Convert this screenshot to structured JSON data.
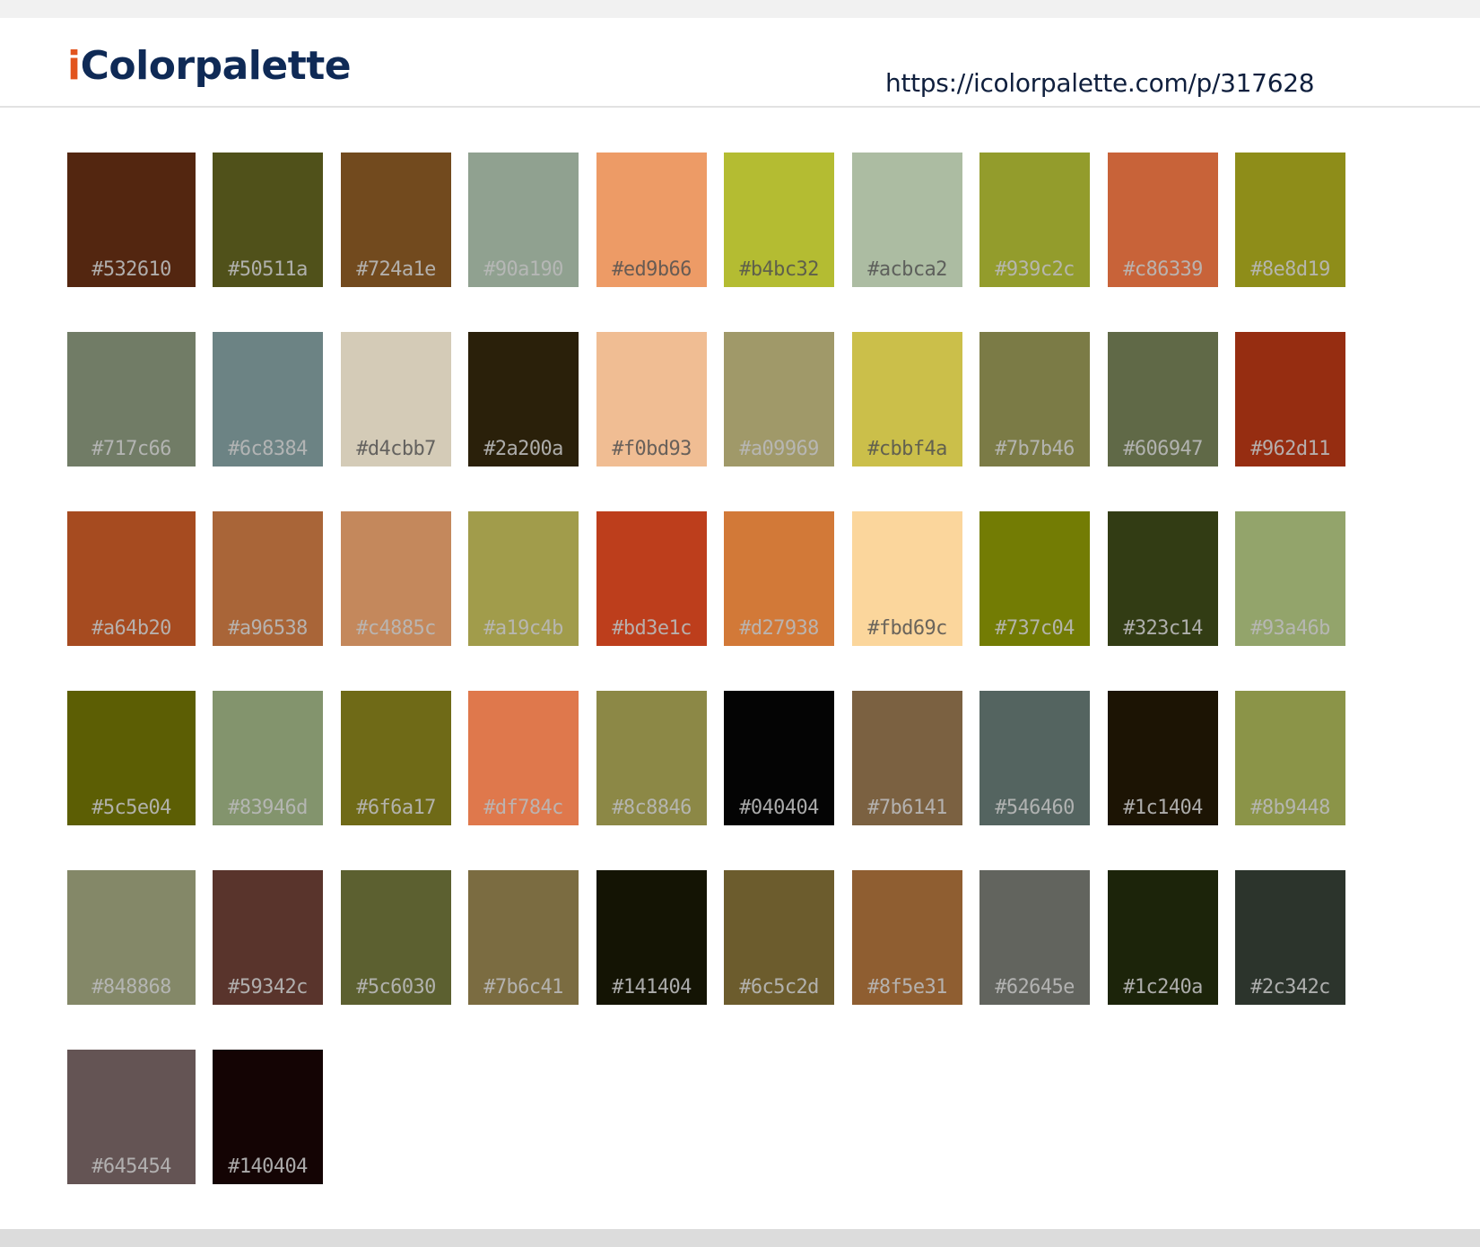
{
  "header": {
    "logo_i": "i",
    "logo_rest": "Colorpalette",
    "url": "https://icolorpalette.com/p/317628"
  },
  "swatches": [
    {
      "hex": "#532610",
      "label": "#532610"
    },
    {
      "hex": "#50511a",
      "label": "#50511a"
    },
    {
      "hex": "#724a1e",
      "label": "#724a1e"
    },
    {
      "hex": "#90a190",
      "label": "#90a190"
    },
    {
      "hex": "#ed9b66",
      "label": "#ed9b66"
    },
    {
      "hex": "#b4bc32",
      "label": "#b4bc32"
    },
    {
      "hex": "#acbca2",
      "label": "#acbca2"
    },
    {
      "hex": "#939c2c",
      "label": "#939c2c"
    },
    {
      "hex": "#c86339",
      "label": "#c86339"
    },
    {
      "hex": "#8e8d19",
      "label": "#8e8d19"
    },
    {
      "hex": "#717c66",
      "label": "#717c66"
    },
    {
      "hex": "#6c8384",
      "label": "#6c8384"
    },
    {
      "hex": "#d4cbb7",
      "label": "#d4cbb7"
    },
    {
      "hex": "#2a200a",
      "label": "#2a200a"
    },
    {
      "hex": "#f0bd93",
      "label": "#f0bd93"
    },
    {
      "hex": "#a09969",
      "label": "#a09969"
    },
    {
      "hex": "#cbbf4a",
      "label": "#cbbf4a"
    },
    {
      "hex": "#7b7b46",
      "label": "#7b7b46"
    },
    {
      "hex": "#606947",
      "label": "#606947"
    },
    {
      "hex": "#962d11",
      "label": "#962d11"
    },
    {
      "hex": "#a64b20",
      "label": "#a64b20"
    },
    {
      "hex": "#a96538",
      "label": "#a96538"
    },
    {
      "hex": "#c4885c",
      "label": "#c4885c"
    },
    {
      "hex": "#a19c4b",
      "label": "#a19c4b"
    },
    {
      "hex": "#bd3e1c",
      "label": "#bd3e1c"
    },
    {
      "hex": "#d27938",
      "label": "#d27938"
    },
    {
      "hex": "#fbd69c",
      "label": "#fbd69c"
    },
    {
      "hex": "#737c04",
      "label": "#737c04"
    },
    {
      "hex": "#323c14",
      "label": "#323c14"
    },
    {
      "hex": "#93a46b",
      "label": "#93a46b"
    },
    {
      "hex": "#5c5e04",
      "label": "#5c5e04"
    },
    {
      "hex": "#83946d",
      "label": "#83946d"
    },
    {
      "hex": "#6f6a17",
      "label": "#6f6a17"
    },
    {
      "hex": "#df784c",
      "label": "#df784c"
    },
    {
      "hex": "#8c8846",
      "label": "#8c8846"
    },
    {
      "hex": "#040404",
      "label": "#040404"
    },
    {
      "hex": "#7b6141",
      "label": "#7b6141"
    },
    {
      "hex": "#546460",
      "label": "#546460"
    },
    {
      "hex": "#1c1404",
      "label": "#1c1404"
    },
    {
      "hex": "#8b9448",
      "label": "#8b9448"
    },
    {
      "hex": "#848868",
      "label": "#848868"
    },
    {
      "hex": "#59342c",
      "label": "#59342c"
    },
    {
      "hex": "#5c6030",
      "label": "#5c6030"
    },
    {
      "hex": "#7b6c41",
      "label": "#7b6c41"
    },
    {
      "hex": "#141404",
      "label": "#141404"
    },
    {
      "hex": "#6c5c2d",
      "label": "#6c5c2d"
    },
    {
      "hex": "#8f5e31",
      "label": "#8f5e31"
    },
    {
      "hex": "#62645e",
      "label": "#62645e"
    },
    {
      "hex": "#1c240a",
      "label": "#1c240a"
    },
    {
      "hex": "#2c342c",
      "label": "#2c342c"
    },
    {
      "hex": "#645454",
      "label": "#645454"
    },
    {
      "hex": "#140404",
      "label": "#140404"
    }
  ]
}
